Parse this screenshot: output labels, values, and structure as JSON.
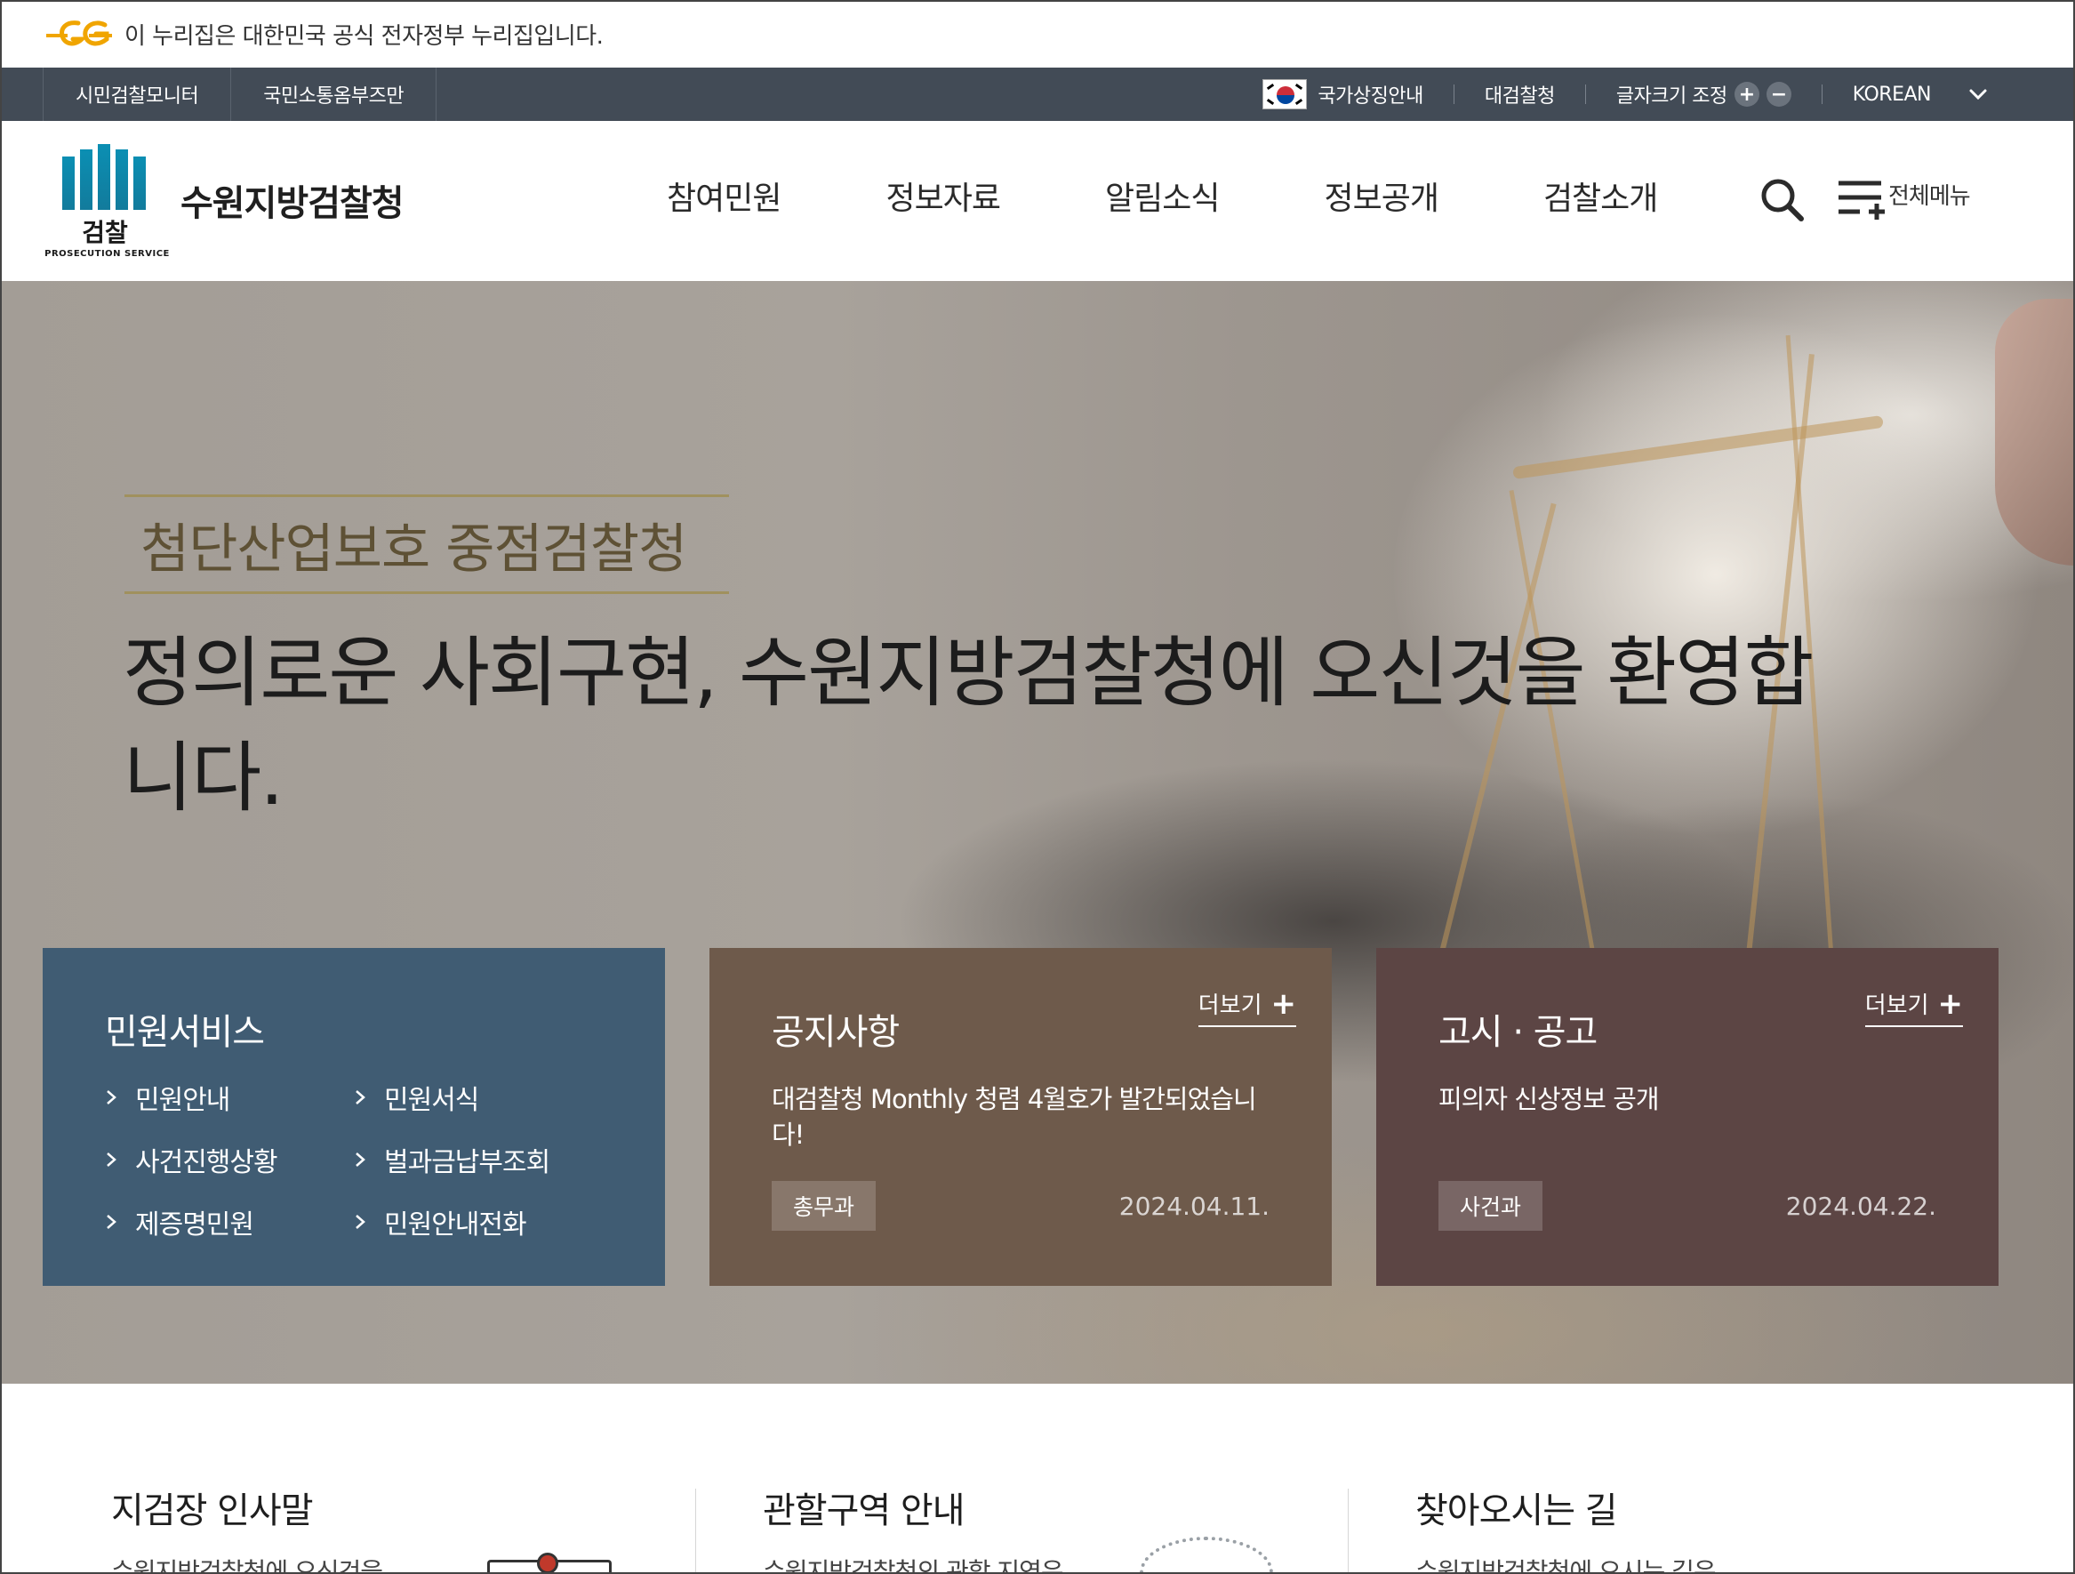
{
  "gov_banner": {
    "text": "이 누리집은 대한민국 공식 전자정부 누리집입니다."
  },
  "util_bar": {
    "left_links": [
      "시민검찰모니터",
      "국민소통옴부즈만"
    ],
    "national_symbol": "국가상징안내",
    "supreme_office": "대검찰청",
    "font_size_label": "글자크기 조정",
    "font_increase": "+",
    "font_decrease": "−",
    "language": "KOREAN"
  },
  "header": {
    "logo_korean": "검찰",
    "logo_english": "PROSECUTION SERVICE",
    "site_name": "수원지방검찰청",
    "nav": [
      "참여민원",
      "정보자료",
      "알림소식",
      "정보공개",
      "검찰소개"
    ],
    "all_menu": "전체메뉴"
  },
  "hero": {
    "tagline": "첨단산업보호 중점검찰청",
    "title": "정의로운 사회구현, 수원지방검찰청에 오신것을 환영합니다."
  },
  "panels": {
    "civil": {
      "title": "민원서비스",
      "items": [
        "민원안내",
        "민원서식",
        "사건진행상황",
        "벌과금납부조회",
        "제증명민원",
        "민원안내전화"
      ]
    },
    "notice": {
      "title": "공지사항",
      "more": "더보기",
      "post_title": "대검찰청 Monthly 청렴 4월호가 발간되었습니다!",
      "post_dept": "총무과",
      "post_date": "2024.04.11."
    },
    "announce": {
      "title": "고시 · 공고",
      "more": "더보기",
      "post_title": "피의자 신상정보 공개",
      "post_dept": "사건과",
      "post_date": "2024.04.22."
    }
  },
  "bottom": {
    "greeting": {
      "title": "지검장 인사말",
      "text": "수원지방검찰청에 오신것을"
    },
    "jurisdiction": {
      "title": "관할구역 안내",
      "text": "수원지방검찰청의 관할 지역은"
    },
    "directions": {
      "title": "찾아오시는 길",
      "text": "수원지방검찰청에 오시는 길은"
    }
  },
  "colors": {
    "util_bar": "#424b56",
    "civil_panel": "#405c73",
    "notice_panel": "#6e5a4b",
    "announce_panel": "#5c4544",
    "tagline": "#5e5135",
    "logo_accent": "#0b8fb3"
  },
  "icons": {
    "gov_logo": "eg-logo-icon",
    "flag": "korea-flag-icon",
    "language_toggle": "chevron-down-icon",
    "search": "search-icon",
    "all_menu": "menu-plus-icon",
    "list_bullet": "chevron-right-icon",
    "more": "plus-icon"
  }
}
